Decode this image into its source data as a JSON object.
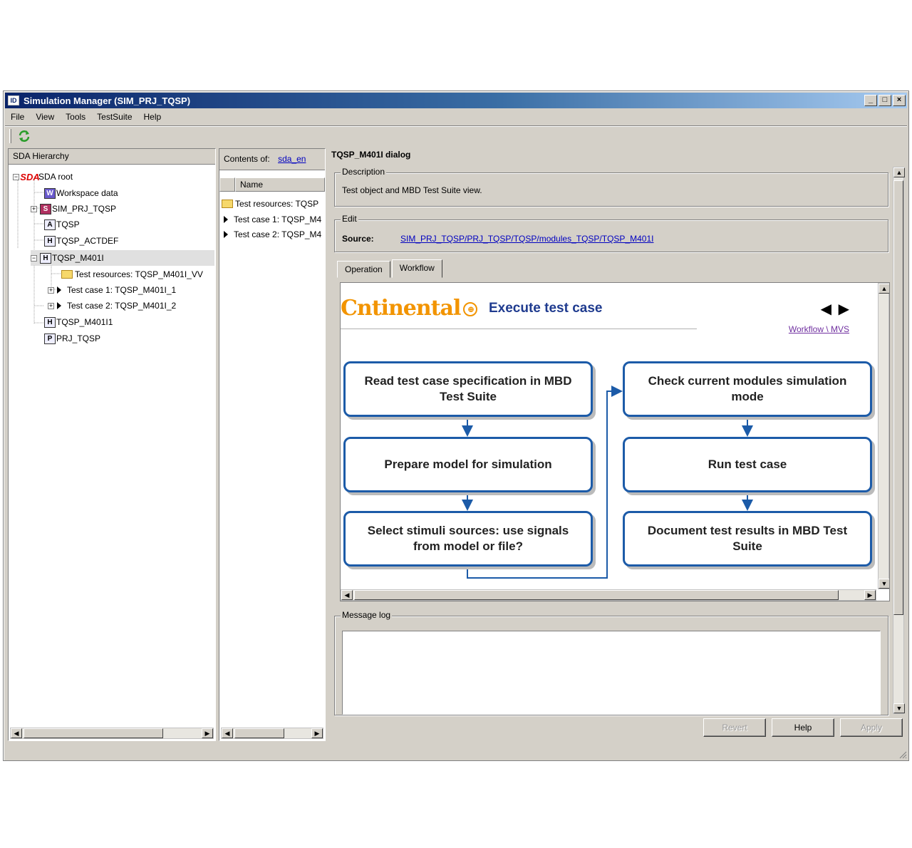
{
  "window": {
    "title": "Simulation Manager (SIM_PRJ_TQSP)",
    "icon_text": "ID",
    "controls": [
      "_",
      "□",
      "×"
    ]
  },
  "menu": [
    "File",
    "View",
    "Tools",
    "TestSuite",
    "Help"
  ],
  "hierarchy": {
    "header": "SDA Hierarchy",
    "items": [
      {
        "label": "SDA root",
        "icon": "SDA"
      },
      {
        "label": "Workspace data",
        "icon": "W"
      },
      {
        "label": "SIM_PRJ_TQSP",
        "icon": "S"
      },
      {
        "label": "TQSP",
        "icon": "A"
      },
      {
        "label": "TQSP_ACTDEF",
        "icon": "H"
      },
      {
        "label": "TQSP_M401I",
        "icon": "H"
      },
      {
        "label": "Test resources: TQSP_M401I_VV",
        "icon": "folder"
      },
      {
        "label": "Test case 1: TQSP_M401I_1",
        "icon": "play"
      },
      {
        "label": "Test case 2: TQSP_M401I_2",
        "icon": "play"
      },
      {
        "label": "TQSP_M401I1",
        "icon": "H"
      },
      {
        "label": "PRJ_TQSP",
        "icon": "P"
      }
    ]
  },
  "contents": {
    "label": "Contents of:",
    "value": "sda_en",
    "column_name": "Name",
    "items": [
      {
        "label": "Test resources: TQSP",
        "icon": "folder"
      },
      {
        "label": "Test case 1: TQSP_M4",
        "icon": "play"
      },
      {
        "label": "Test case 2: TQSP_M4",
        "icon": "play"
      }
    ]
  },
  "dialog": {
    "title": "TQSP_M401I dialog",
    "description_legend": "Description",
    "description_text": "Test object and MBD Test Suite view.",
    "edit_legend": "Edit",
    "source_label": "Source:",
    "source_link": "SIM_PRJ_TQSP/PRJ_TQSP/TQSP/modules_TQSP/TQSP_M401I",
    "tabs": [
      {
        "label": "Operation",
        "active": false
      },
      {
        "label": "Workflow",
        "active": true
      }
    ]
  },
  "workflow": {
    "logo": "ntinental",
    "logo_c": "C",
    "title": "Execute test case",
    "nav": "◀ ▶",
    "links": "Workflow \\ MVS",
    "steps_left": [
      "Read test case specification in MBD Test Suite",
      "Prepare model for simulation",
      "Select stimuli sources: use signals from model or file?"
    ],
    "steps_right": [
      "Check current modules simulation mode",
      "Run test case",
      "Document test results in MBD Test Suite"
    ],
    "colors": {
      "box_border": "#1c5ba8",
      "logo": "#f29400",
      "title": "#1f3b8f"
    }
  },
  "message_log": {
    "legend": "Message log",
    "text": ""
  },
  "buttons": {
    "revert": "Revert",
    "help": "Help",
    "apply": "Apply"
  }
}
